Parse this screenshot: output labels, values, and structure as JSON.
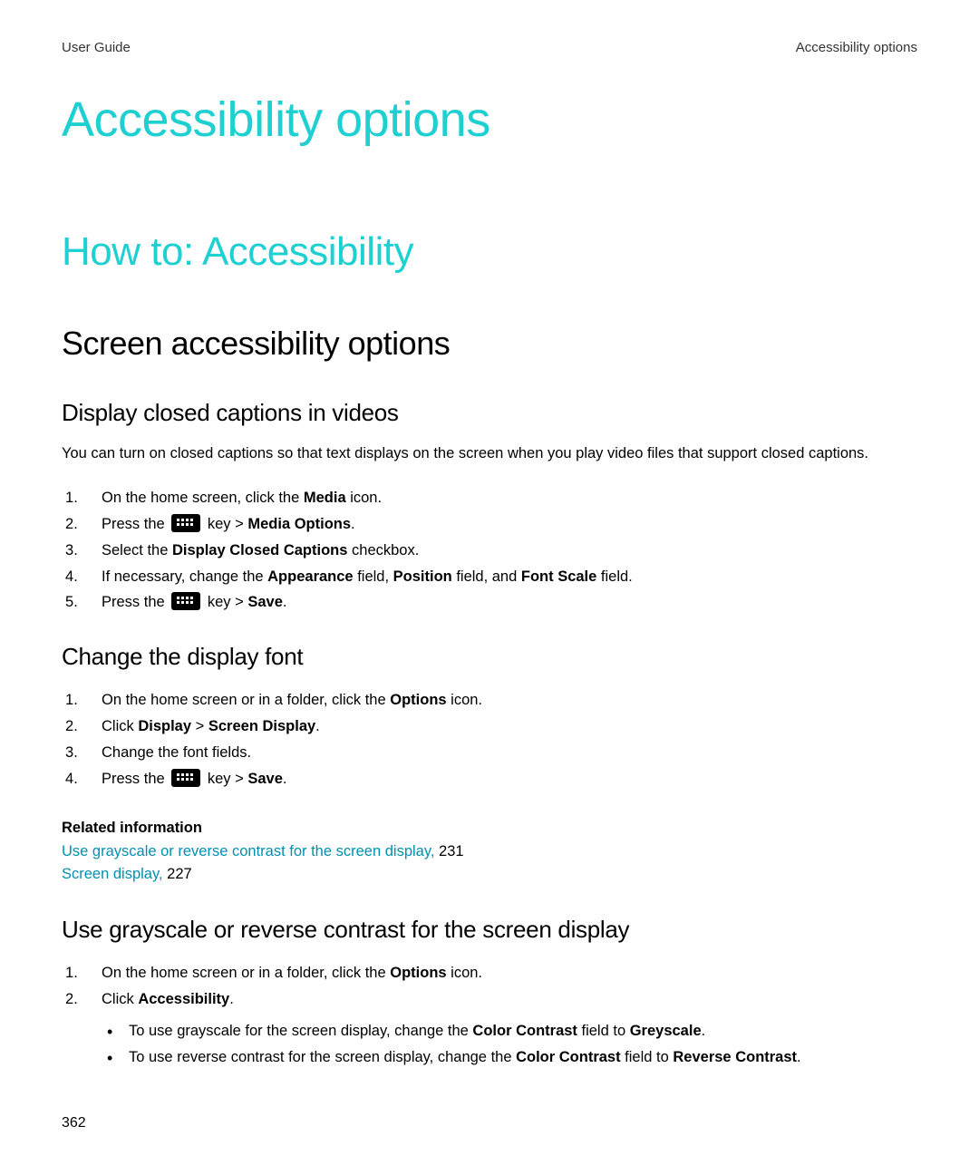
{
  "header": {
    "left": "User Guide",
    "right": "Accessibility options"
  },
  "title1": "Accessibility options",
  "title2": "How to: Accessibility",
  "section1": "Screen accessibility options",
  "sub1": {
    "title": "Display closed captions in videos",
    "intro": "You can turn on closed captions so that text displays on the screen when you play video files that support closed captions.",
    "steps": {
      "s1a": "On the home screen, click the ",
      "s1b": "Media",
      "s1c": " icon.",
      "s2a": "Press the ",
      "s2b": " key > ",
      "s2c": "Media Options",
      "s2d": ".",
      "s3a": "Select the ",
      "s3b": "Display Closed Captions",
      "s3c": " checkbox.",
      "s4a": "If necessary, change the ",
      "s4b": "Appearance",
      "s4c": " field, ",
      "s4d": "Position",
      "s4e": " field, and ",
      "s4f": "Font Scale",
      "s4g": " field.",
      "s5a": "Press the ",
      "s5b": " key > ",
      "s5c": "Save",
      "s5d": "."
    }
  },
  "sub2": {
    "title": "Change the display font",
    "steps": {
      "s1a": "On the home screen or in a folder, click the ",
      "s1b": "Options",
      "s1c": " icon.",
      "s2a": "Click ",
      "s2b": "Display",
      "s2c": " > ",
      "s2d": "Screen Display",
      "s2e": ".",
      "s3": "Change the font fields.",
      "s4a": "Press the ",
      "s4b": " key > ",
      "s4c": "Save",
      "s4d": "."
    }
  },
  "related": {
    "title": "Related information",
    "link1_text": "Use grayscale or reverse contrast for the screen display,",
    "link1_page": " 231",
    "link2_text": "Screen display,",
    "link2_page": " 227"
  },
  "sub3": {
    "title": "Use grayscale or reverse contrast for the screen display",
    "steps": {
      "s1a": "On the home screen or in a folder, click the ",
      "s1b": "Options",
      "s1c": " icon.",
      "s2a": "Click ",
      "s2b": "Accessibility",
      "s2c": ".",
      "b1a": "To use grayscale for the screen display, change the ",
      "b1b": "Color Contrast",
      "b1c": " field to ",
      "b1d": "Greyscale",
      "b1e": ".",
      "b2a": "To use reverse contrast for the screen display, change the ",
      "b2b": "Color Contrast",
      "b2c": " field to ",
      "b2d": "Reverse Contrast",
      "b2e": "."
    }
  },
  "page_number": "362"
}
